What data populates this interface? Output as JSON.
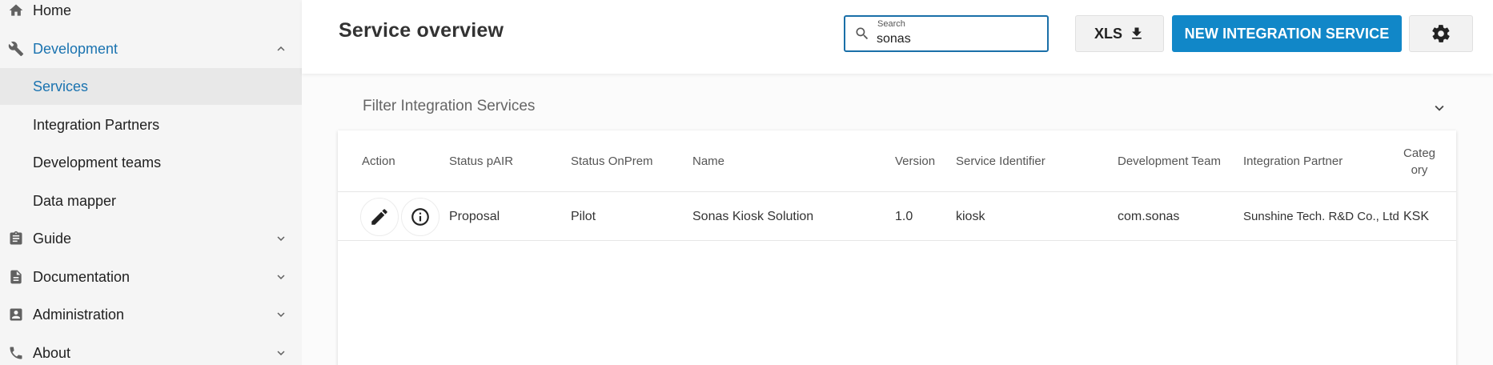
{
  "sidebar": {
    "items": [
      {
        "label": "Home",
        "icon": "home-icon"
      },
      {
        "label": "Development",
        "icon": "wrench-icon",
        "expanded": true,
        "children": [
          {
            "label": "Services",
            "selected": true
          },
          {
            "label": "Integration Partners"
          },
          {
            "label": "Development teams"
          },
          {
            "label": "Data mapper"
          }
        ]
      },
      {
        "label": "Guide",
        "icon": "clipboard-icon"
      },
      {
        "label": "Documentation",
        "icon": "document-icon"
      },
      {
        "label": "Administration",
        "icon": "account-box-icon"
      },
      {
        "label": "About",
        "icon": "phone-icon"
      }
    ]
  },
  "header": {
    "title": "Service overview",
    "search": {
      "label": "Search",
      "value": "sonas"
    },
    "xls_label": "XLS",
    "new_button_label": "NEW INTEGRATION SERVICE"
  },
  "filter": {
    "label": "Filter Integration Services"
  },
  "table": {
    "columns": [
      "Action",
      "Status pAIR",
      "Status OnPrem",
      "Name",
      "Version",
      "Service Identifier",
      "Development Team",
      "Integration Partner",
      "Categ\nory"
    ],
    "rows": [
      {
        "status_pair": "Proposal",
        "status_onprem": "Pilot",
        "name": "Sonas Kiosk Solution",
        "version": "1.0",
        "service_identifier": "kiosk",
        "development_team": "com.sonas",
        "integration_partner": "Sunshine Tech. R&D Co., Ltd",
        "category": "KSK"
      }
    ]
  },
  "colors": {
    "accent": "#1187c8",
    "active_text": "#1a73b0",
    "sidebar_bg": "#f5f5f5",
    "selected_bg": "#e8e8e8"
  }
}
